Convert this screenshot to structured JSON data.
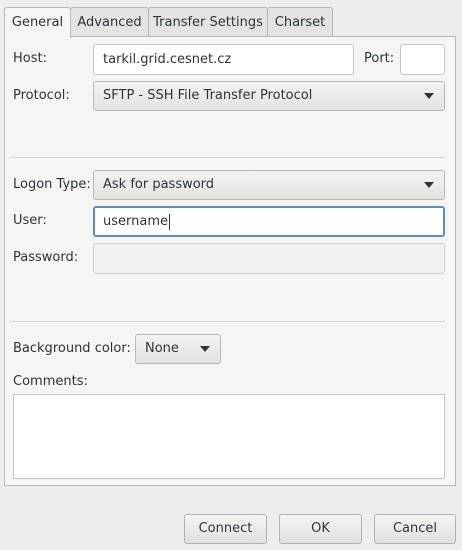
{
  "tabs": [
    {
      "label": "General"
    },
    {
      "label": "Advanced"
    },
    {
      "label": "Transfer Settings"
    },
    {
      "label": "Charset"
    }
  ],
  "general": {
    "host_label": "Host:",
    "host_value": "tarkil.grid.cesnet.cz",
    "port_label": "Port:",
    "port_value": "",
    "protocol_label": "Protocol:",
    "protocol_value": "SFTP - SSH File Transfer Protocol",
    "logon_type_label": "Logon Type:",
    "logon_type_value": "Ask for password",
    "user_label": "User:",
    "user_value": "username",
    "password_label": "Password:",
    "password_value": "",
    "bg_color_label": "Background color:",
    "bg_color_value": "None",
    "comments_label": "Comments:",
    "comments_value": ""
  },
  "buttons": {
    "connect": "Connect",
    "ok": "OK",
    "cancel": "Cancel"
  },
  "colors": {
    "focus_border": "#5b8cc4",
    "window_bg": "#eeeded"
  }
}
